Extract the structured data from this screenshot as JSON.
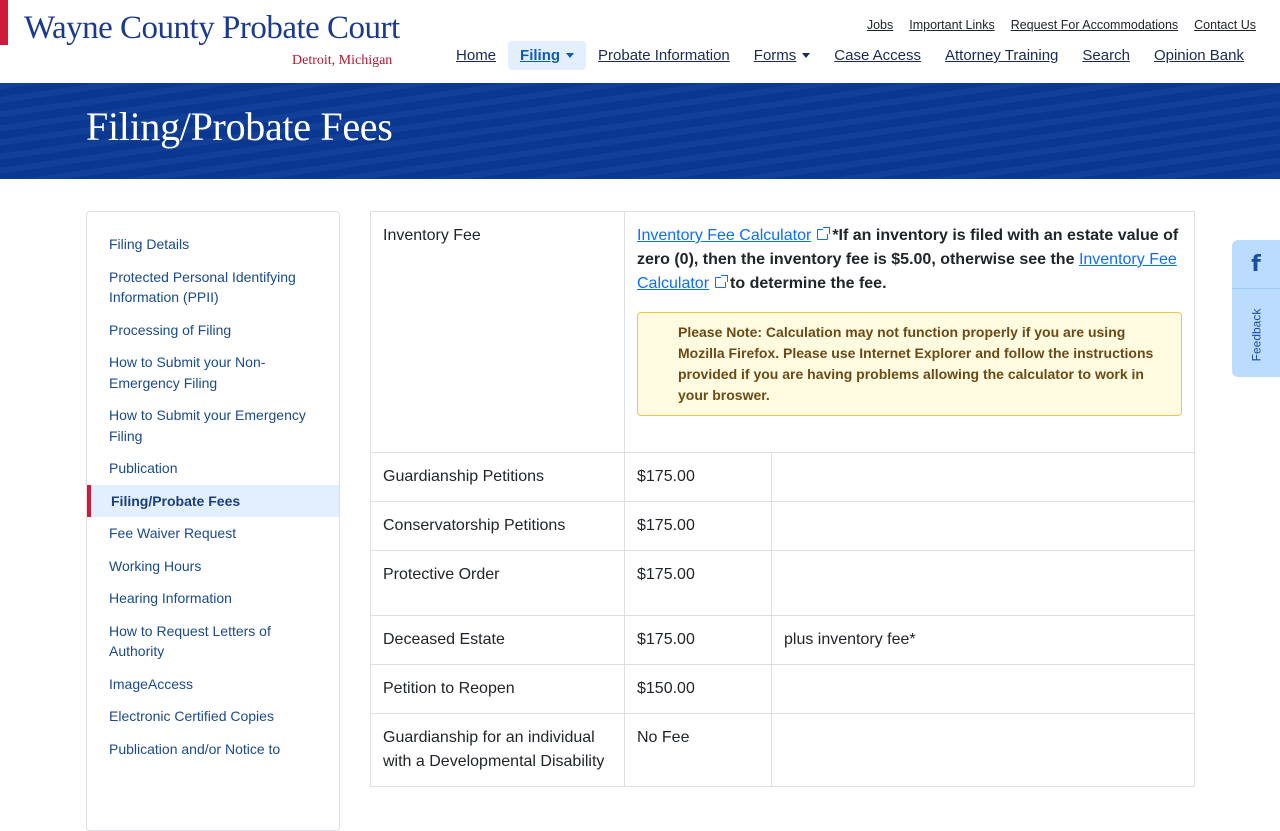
{
  "site": {
    "title": "Wayne County Probate Court",
    "subtitle": "Detroit, Michigan"
  },
  "util_links": [
    "Jobs",
    "Important Links",
    "Request For Accommodations",
    "Contact Us"
  ],
  "nav": {
    "home": "Home",
    "filing": "Filing",
    "probate_info": "Probate Information",
    "forms": "Forms",
    "case_access": "Case Access",
    "attorney_training": "Attorney Training",
    "search": "Search",
    "opinion_bank": "Opinion Bank"
  },
  "banner": {
    "heading": "Filing/Probate Fees"
  },
  "sidebar": {
    "items": [
      "Filing Details",
      "Protected Personal Identifying Information (PPII)",
      "Processing of Filing",
      "How to Submit your Non-Emergency Filing",
      "How to Submit your Emergency Filing",
      "Publication",
      "Filing/Probate Fees",
      "Fee Waiver Request",
      "Working Hours",
      "Hearing Information",
      "How to Request Letters of Authority",
      "ImageAccess",
      "Electronic Certified Copies",
      "Publication and/or Notice to"
    ],
    "active_index": 6
  },
  "inventory": {
    "name": "Inventory Fee",
    "link1": "Inventory Fee Calculator",
    "text1": "*If an inventory is filed with an estate value of zero (0), then the inventory fee is $5.00, otherwise see the",
    "link2": "Inventory Fee Calculator",
    "text2": "to determine the fee.",
    "note": "Please Note: Calculation may not function properly if you are using Mozilla Firefox. Please use Internet Explorer and follow the instructions provided if you are having problems allowing the calculator to work in your broswer."
  },
  "fees": [
    {
      "name": "Guardianship Petitions",
      "amount": "$175.00",
      "note": ""
    },
    {
      "name": "Conservatorship Petitions",
      "amount": "$175.00",
      "note": ""
    },
    {
      "name": "Protective Order",
      "amount": "$175.00",
      "note": ""
    },
    {
      "name": "Deceased Estate",
      "amount": "$175.00",
      "note": "plus inventory fee*"
    },
    {
      "name": "Petition to Reopen",
      "amount": "$150.00",
      "note": ""
    },
    {
      "name": "Guardianship for an individual with a Developmental Disability",
      "amount": "No Fee",
      "note": ""
    }
  ],
  "feedback": {
    "label": "Feedback",
    "fb_glyph": "f"
  },
  "colors": {
    "brand_blue": "#1c3a8b",
    "banner_blue": "#0a3a96",
    "accent_red": "#d01a3c",
    "link_blue": "#0d6efd"
  }
}
